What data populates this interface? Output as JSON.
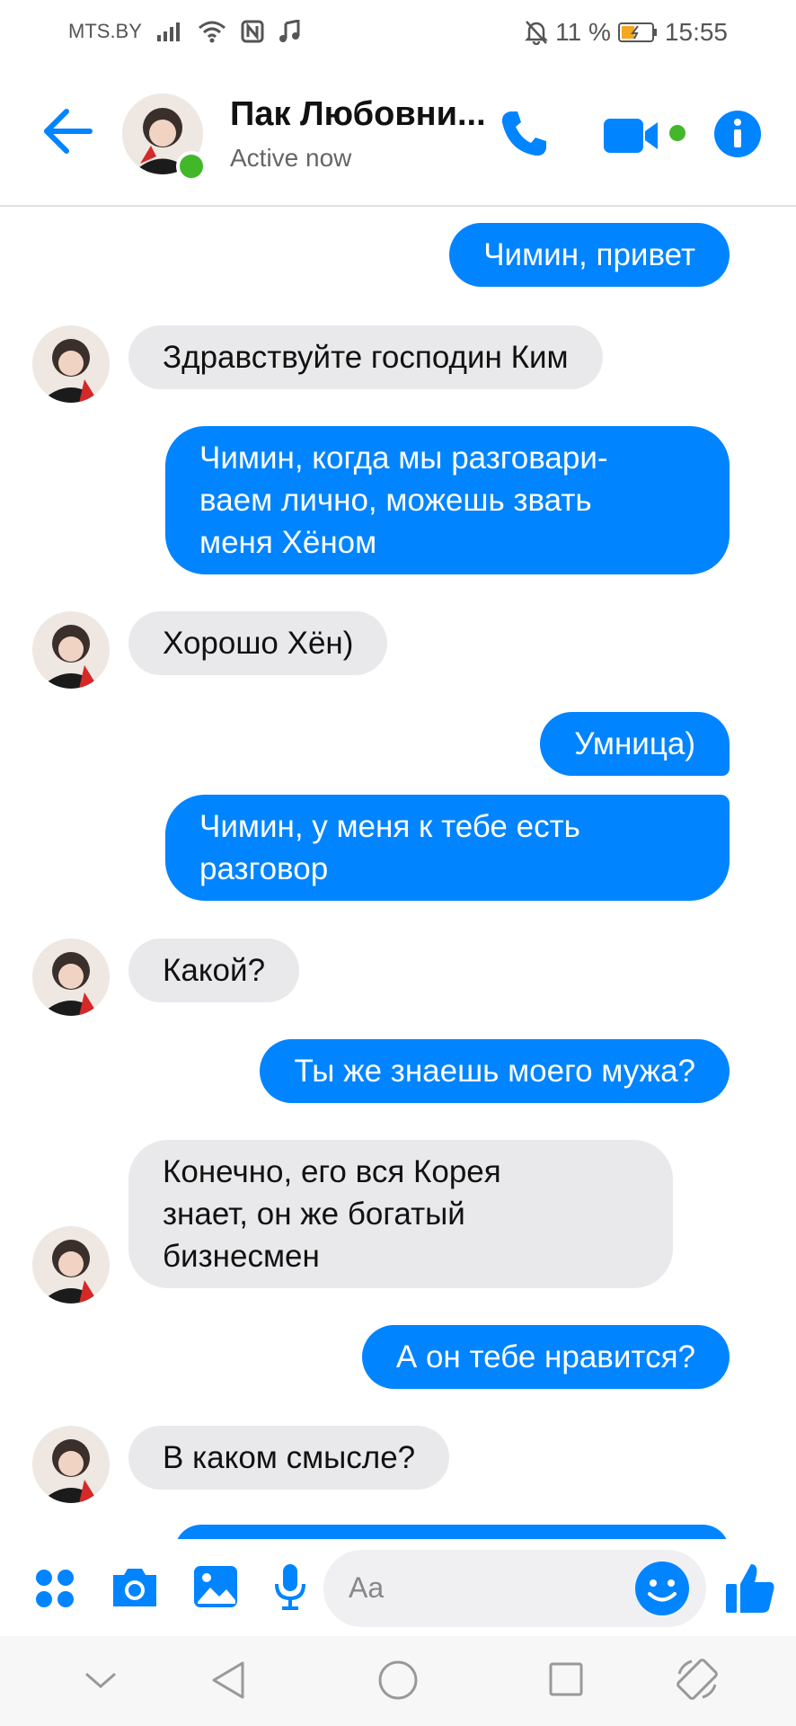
{
  "status_bar": {
    "carrier": "MTS.BY",
    "battery": "11 %",
    "time": "15:55"
  },
  "header": {
    "name": "Пак Любовни...",
    "status": "Active now"
  },
  "messages": [
    {
      "side": "out",
      "text": "Чимин, привет"
    },
    {
      "side": "in",
      "text": "Здравствуйте господин Ким"
    },
    {
      "side": "out",
      "text": "Чимин, когда мы разговари-\nваем лично, можешь звать\nменя Хёном"
    },
    {
      "side": "in",
      "text": "Хорошо Хён)"
    },
    {
      "side": "out",
      "text": "Умница)"
    },
    {
      "side": "out",
      "text": "Чимин, у меня к тебе есть\nразговор"
    },
    {
      "side": "in",
      "text": "Какой?"
    },
    {
      "side": "out",
      "text": "Ты же знаешь моего мужа?"
    },
    {
      "side": "in",
      "text": "Конечно, его вся Корея\nзнает, он же богатый\nбизнесмен"
    },
    {
      "side": "out",
      "text": "А он тебе нравится?"
    },
    {
      "side": "in",
      "text": "В каком смысле?"
    }
  ],
  "composer": {
    "placeholder": "Aa"
  },
  "colors": {
    "accent": "#0084ff",
    "incoming_bubble": "#e9e9eb",
    "online": "#42b72a"
  }
}
